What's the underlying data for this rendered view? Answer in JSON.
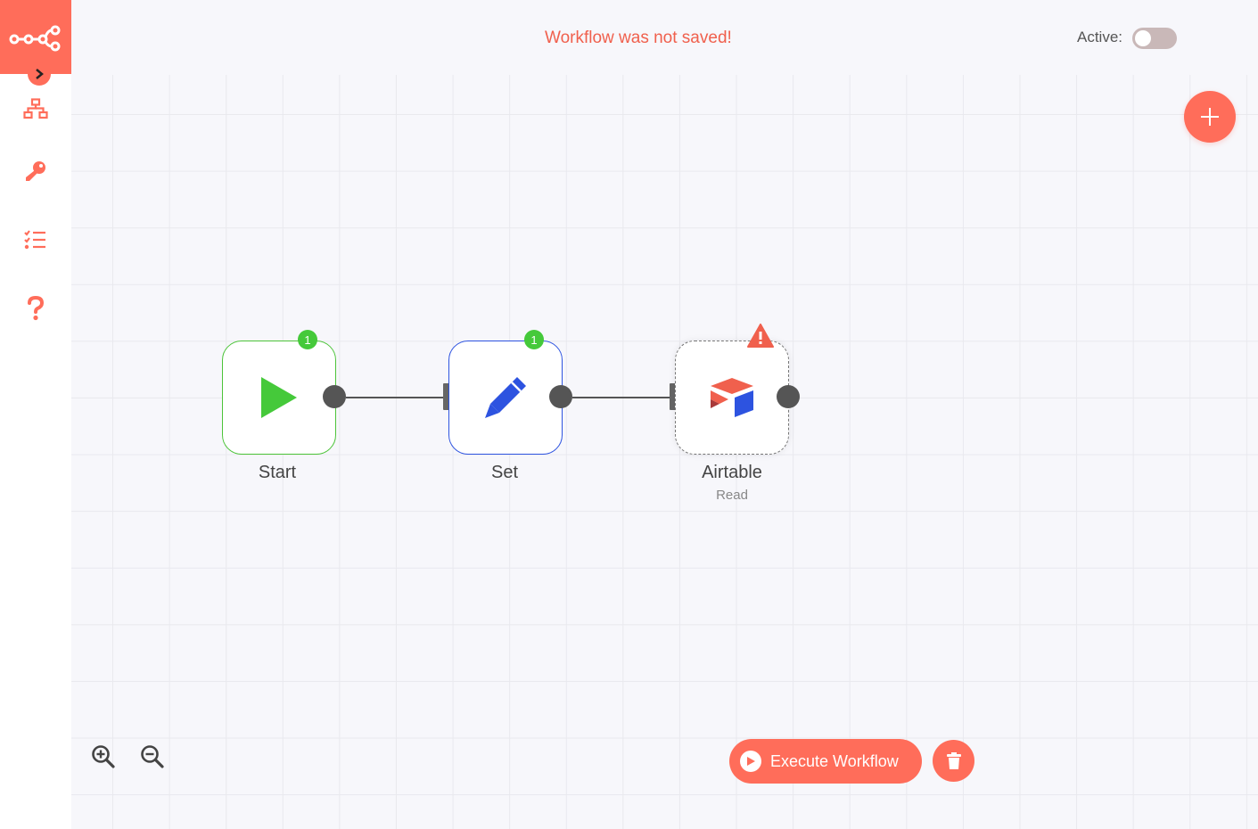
{
  "header": {
    "unsaved_message": "Workflow was not saved!",
    "active_label": "Active:",
    "active_state": false
  },
  "sidebar": {
    "logo_icon": "n8n-logo-icon",
    "expand_icon": "chevron-right-icon",
    "items": [
      {
        "name": "workflows",
        "icon": "sitemap-icon"
      },
      {
        "name": "credentials",
        "icon": "key-icon"
      },
      {
        "name": "executions",
        "icon": "tasks-list-icon"
      },
      {
        "name": "help",
        "icon": "question-icon"
      }
    ]
  },
  "canvas": {
    "add_node_icon": "plus-icon",
    "nodes": [
      {
        "id": "start",
        "label": "Start",
        "subtitle": "",
        "icon": "play-icon",
        "badge": "1",
        "status_color": "#4cc439"
      },
      {
        "id": "set",
        "label": "Set",
        "subtitle": "",
        "icon": "pencil-icon",
        "badge": "1",
        "status_color": "#2d53e0"
      },
      {
        "id": "airtable",
        "label": "Airtable",
        "subtitle": "Read",
        "icon": "airtable-icon",
        "badge": "",
        "warning_icon": "warning-triangle-icon"
      }
    ],
    "zoom": [
      {
        "name": "zoom-in",
        "icon": "zoom-in-icon"
      },
      {
        "name": "zoom-out",
        "icon": "zoom-out-icon"
      }
    ]
  },
  "actions": {
    "execute_label": "Execute Workflow",
    "execute_icon": "play-circle-icon",
    "delete_icon": "trash-icon"
  },
  "colors": {
    "accent": "#ff6d5a",
    "warning_text": "#f0604d",
    "success": "#45c93a",
    "set_blue": "#2d53e0"
  }
}
